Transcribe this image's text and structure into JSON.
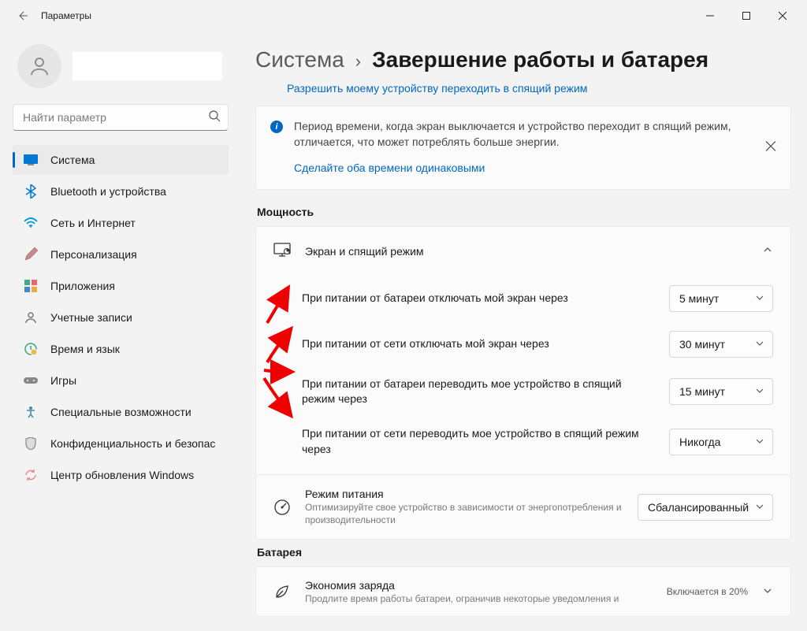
{
  "window": {
    "title": "Параметры"
  },
  "search": {
    "placeholder": "Найти параметр"
  },
  "nav": {
    "items": [
      {
        "label": "Система"
      },
      {
        "label": "Bluetooth и устройства"
      },
      {
        "label": "Сеть и Интернет"
      },
      {
        "label": "Персонализация"
      },
      {
        "label": "Приложения"
      },
      {
        "label": "Учетные записи"
      },
      {
        "label": "Время и язык"
      },
      {
        "label": "Игры"
      },
      {
        "label": "Специальные возможности"
      },
      {
        "label": "Конфиденциальность и безопас"
      },
      {
        "label": "Центр обновления Windows"
      }
    ]
  },
  "breadcrumb": {
    "parent": "Система",
    "current": "Завершение работы и батарея"
  },
  "links": {
    "allow_sleep": "Разрешить моему устройству переходить в спящий режим"
  },
  "info_card": {
    "text": "Период времени, когда экран выключается и устройство переходит в спящий режим, отличается, что может потреблять больше энергии.",
    "action": "Сделайте оба времени одинаковыми"
  },
  "sections": {
    "power": "Мощность",
    "battery": "Батарея"
  },
  "screen_sleep": {
    "title": "Экран и спящий режим",
    "rows": [
      {
        "label": "При питании от батареи отключать мой экран через",
        "value": "5 минут"
      },
      {
        "label": "При питании от сети отключать мой экран через",
        "value": "30 минут"
      },
      {
        "label": "При питании от батареи переводить мое устройство в спящий режим через",
        "value": "15 минут"
      },
      {
        "label": "При питании от сети переводить мое устройство в спящий режим через",
        "value": "Никогда"
      }
    ]
  },
  "power_mode": {
    "title": "Режим питания",
    "subtitle": "Оптимизируйте свое устройство в зависимости от энергопотребления и производительности",
    "value": "Сбалансированный"
  },
  "battery_saver": {
    "title": "Экономия заряда",
    "subtitle": "Продлите время работы батареи, ограничив некоторые уведомления и",
    "status": "Включается в 20%"
  }
}
